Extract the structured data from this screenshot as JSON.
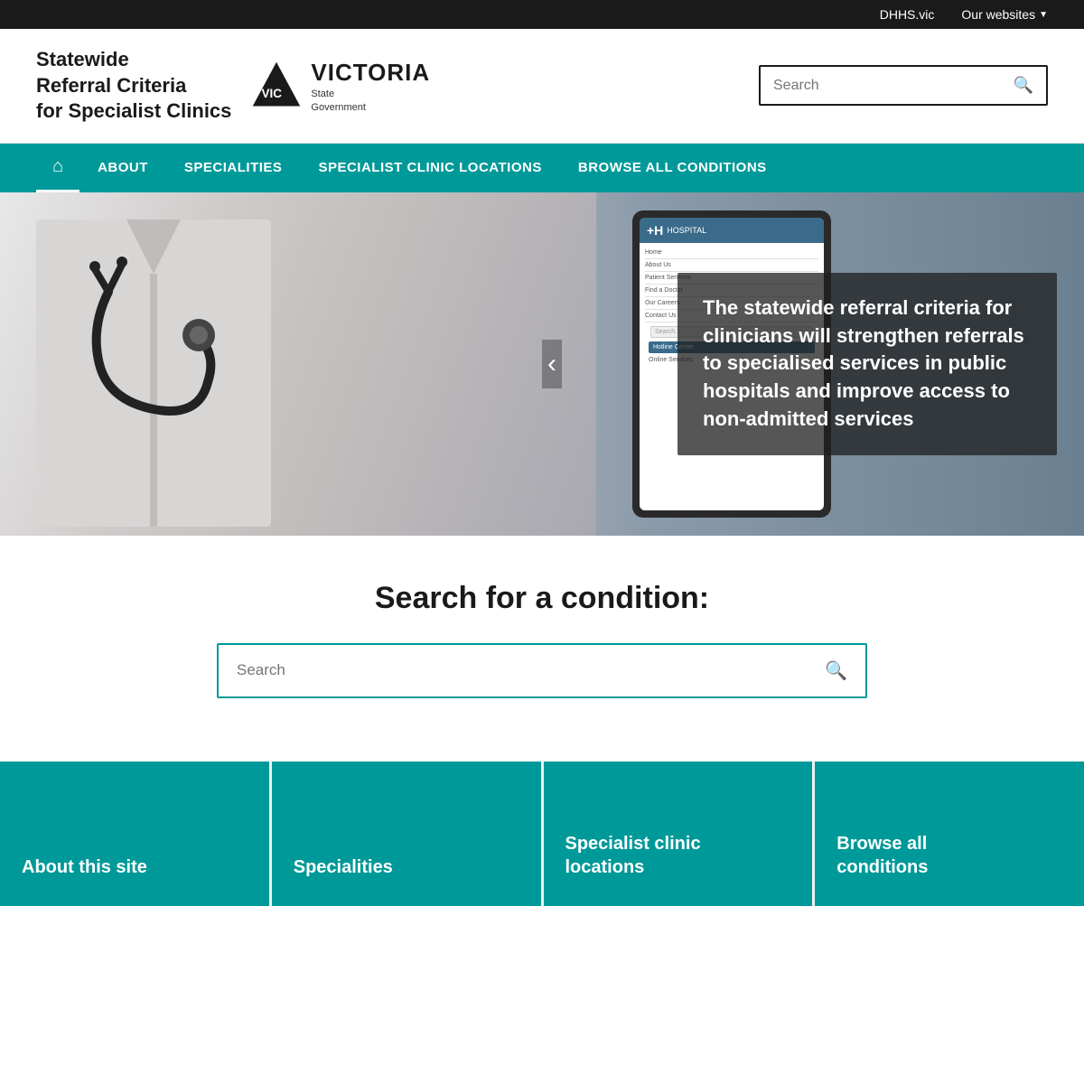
{
  "topbar": {
    "dhhs_link": "DHHS.vic",
    "our_websites": "Our websites"
  },
  "header": {
    "site_title_line1": "Statewide",
    "site_title_line2": "Referral Criteria",
    "site_title_line3": "for Specialist Clinics",
    "victoria_name": "VICTORIA",
    "victoria_sub": "State\nGovernment",
    "search_placeholder": "Search"
  },
  "nav": {
    "about": "ABOUT",
    "specialities": "SPECIALITIES",
    "specialist_clinic_locations": "SPECIALIST CLINIC LOCATIONS",
    "browse_all_conditions": "BROWSE ALL CONDITIONS"
  },
  "hero": {
    "quote": "The statewide referral criteria for clinicians will strengthen referrals to specialised services in public hospitals and improve access to non-admitted services"
  },
  "search_section": {
    "heading": "Search for a condition:",
    "search_placeholder": "Search"
  },
  "cards": [
    {
      "title": "About this site"
    },
    {
      "title": "Specialities"
    },
    {
      "title": "Specialist clinic locations"
    },
    {
      "title": "Browse all conditions"
    }
  ]
}
